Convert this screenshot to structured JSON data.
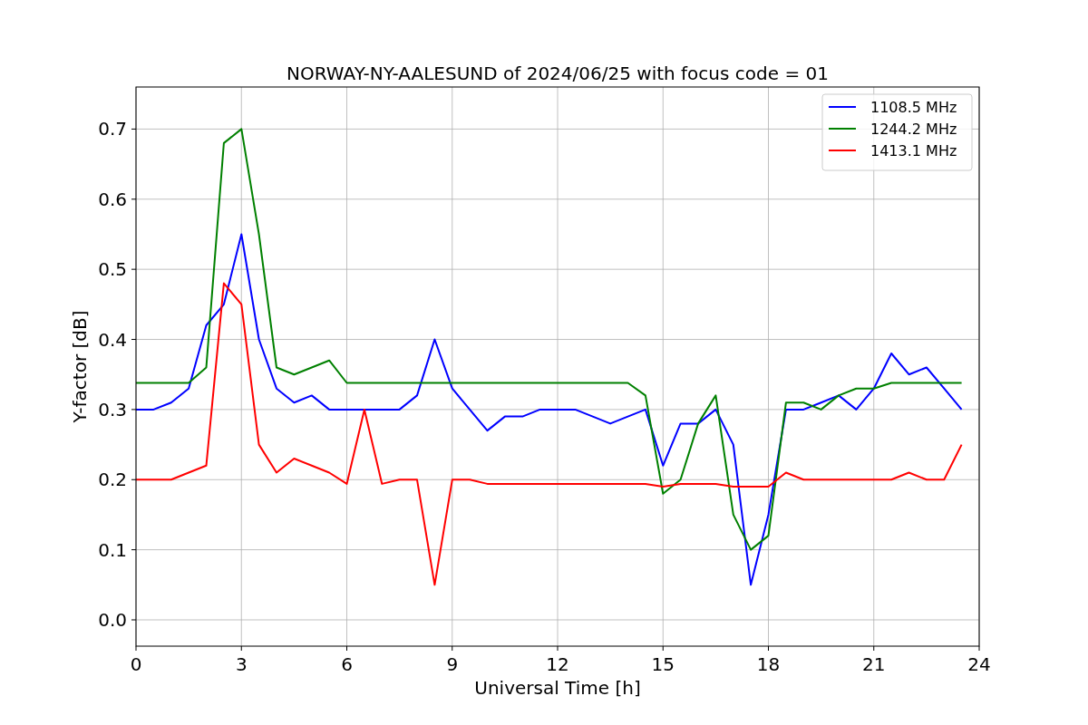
{
  "chart_data": {
    "type": "line",
    "title": "NORWAY-NY-AALESUND of 2024/06/25 with focus code = 01",
    "xlabel": "Universal Time [h]",
    "ylabel": "Y-factor [dB]",
    "x": [
      0,
      0.5,
      1,
      1.5,
      2,
      2.5,
      3,
      3.5,
      4,
      4.5,
      5,
      5.5,
      6,
      6.5,
      7,
      7.5,
      8,
      8.5,
      9,
      9.5,
      10,
      10.5,
      11,
      11.5,
      12,
      12.5,
      13,
      13.5,
      14,
      14.5,
      15,
      15.5,
      16,
      16.5,
      17,
      17.5,
      18,
      18.5,
      19,
      19.5,
      20,
      20.5,
      21,
      21.5,
      22,
      22.5,
      23,
      23.5
    ],
    "series": [
      {
        "name": "1108.5 MHz",
        "color": "#0000ff",
        "values": [
          0.3,
          0.3,
          0.31,
          0.33,
          0.42,
          0.45,
          0.55,
          0.4,
          0.33,
          0.31,
          0.32,
          0.3,
          0.3,
          0.3,
          0.3,
          0.3,
          0.32,
          0.4,
          0.33,
          0.3,
          0.27,
          0.29,
          0.29,
          0.3,
          0.3,
          0.3,
          0.29,
          0.28,
          0.29,
          0.3,
          0.22,
          0.28,
          0.28,
          0.3,
          0.25,
          0.05,
          0.15,
          0.3,
          0.3,
          0.31,
          0.32,
          0.3,
          0.33,
          0.38,
          0.35,
          0.36,
          0.33,
          0.3
        ]
      },
      {
        "name": "1244.2 MHz",
        "color": "#008000",
        "values": [
          0.338,
          0.338,
          0.338,
          0.338,
          0.36,
          0.68,
          0.7,
          0.55,
          0.36,
          0.35,
          0.36,
          0.37,
          0.338,
          0.338,
          0.338,
          0.338,
          0.338,
          0.338,
          0.338,
          0.338,
          0.338,
          0.338,
          0.338,
          0.338,
          0.338,
          0.338,
          0.338,
          0.338,
          0.338,
          0.32,
          0.18,
          0.2,
          0.28,
          0.32,
          0.15,
          0.1,
          0.12,
          0.31,
          0.31,
          0.3,
          0.32,
          0.33,
          0.33,
          0.338,
          0.338,
          0.338,
          0.338,
          0.338
        ]
      },
      {
        "name": "1413.1 MHz",
        "color": "#ff0000",
        "values": [
          0.2,
          0.2,
          0.2,
          0.21,
          0.22,
          0.48,
          0.45,
          0.25,
          0.21,
          0.23,
          0.22,
          0.21,
          0.194,
          0.3,
          0.194,
          0.2,
          0.2,
          0.05,
          0.2,
          0.2,
          0.194,
          0.194,
          0.194,
          0.194,
          0.194,
          0.194,
          0.194,
          0.194,
          0.194,
          0.194,
          0.19,
          0.194,
          0.194,
          0.194,
          0.19,
          0.19,
          0.19,
          0.21,
          0.2,
          0.2,
          0.2,
          0.2,
          0.2,
          0.2,
          0.21,
          0.2,
          0.2,
          0.25
        ]
      }
    ],
    "grid": true,
    "legend": true,
    "xlim": [
      0,
      24
    ],
    "ylim": [
      -0.0375,
      0.76
    ],
    "xticks": [
      0,
      3,
      6,
      9,
      12,
      15,
      18,
      21,
      24
    ],
    "yticks": [
      {
        "value": 0,
        "label": "0.0"
      },
      {
        "value": 0.1,
        "label": "0.1"
      },
      {
        "value": 0.2,
        "label": "0.2"
      },
      {
        "value": 0.3,
        "label": "0.3"
      },
      {
        "value": 0.4,
        "label": "0.4"
      },
      {
        "value": 0.5,
        "label": "0.5"
      },
      {
        "value": 0.6,
        "label": "0.6"
      },
      {
        "value": 0.7,
        "label": "0.7"
      }
    ]
  }
}
